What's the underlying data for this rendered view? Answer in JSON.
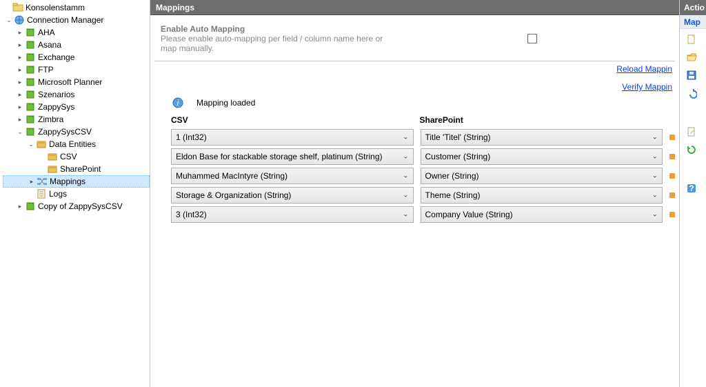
{
  "tree": {
    "root_label": "Konsolenstamm",
    "conn_mgr": "Connection Manager",
    "nodes": [
      "AHA",
      "Asana",
      "Exchange",
      "FTP",
      "Microsoft Planner",
      "Szenarios",
      "ZappySys",
      "Zimbra"
    ],
    "zcsv": "ZappySysCSV",
    "data_entities": "Data Entities",
    "de_children": [
      "CSV",
      "SharePoint"
    ],
    "mappings": "Mappings",
    "logs": "Logs",
    "copy": "Copy of ZappySysCSV"
  },
  "center": {
    "title": "Mappings",
    "automap_header": "Enable Auto Mapping",
    "automap_text": "Please enable auto-mapping per field / column name here or map manually.",
    "link_reload": "Reload Mappin",
    "link_verify": "Verify Mappin",
    "status": "Mapping loaded",
    "col_csv": "CSV",
    "col_sp": "SharePoint",
    "rows": [
      {
        "csv": "1 (Int32)",
        "sp": "Title 'Titel' (String)"
      },
      {
        "csv": "Eldon Base for stackable storage shelf, platinum (String)",
        "sp": "Customer (String)"
      },
      {
        "csv": "Muhammed MacIntyre (String)",
        "sp": "Owner (String)"
      },
      {
        "csv": "Storage & Organization (String)",
        "sp": "Theme (String)"
      },
      {
        "csv": "3 (Int32)",
        "sp": "Company Value (String)"
      }
    ]
  },
  "right": {
    "title": "Actio",
    "subtitle": "Map"
  }
}
